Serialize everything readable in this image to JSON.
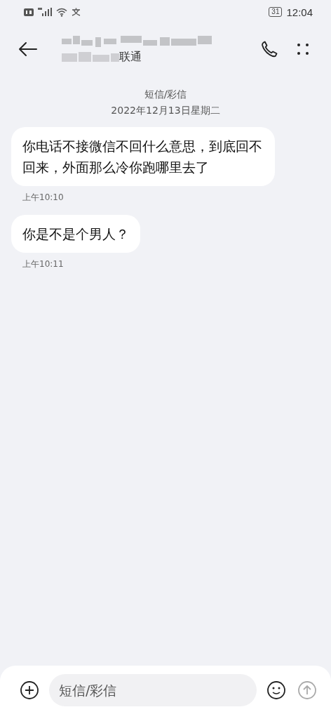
{
  "status_bar": {
    "time": "12:04",
    "battery": "31"
  },
  "header": {
    "carrier": "联通"
  },
  "thread": {
    "channel": "短信/彩信",
    "date": "2022年12月13日星期二"
  },
  "messages": [
    {
      "text": "你电话不接微信不回什么意思，到底回不回来，外面那么冷你跑哪里去了",
      "time": "上午10:10"
    },
    {
      "text": "你是不是个男人？",
      "time": "上午10:11"
    }
  ],
  "composer": {
    "placeholder": "短信/彩信"
  }
}
